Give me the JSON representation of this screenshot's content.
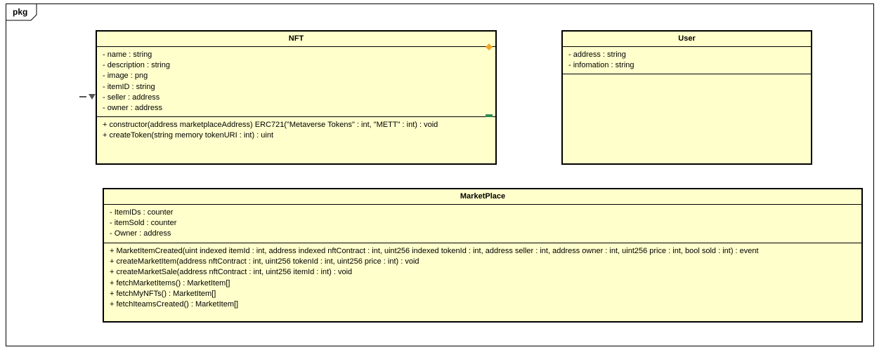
{
  "package": {
    "label": "pkg"
  },
  "classes": {
    "nft": {
      "name": "NFT",
      "attributes": [
        "- name : string",
        "- description : string",
        "- image : png",
        "- itemID : string",
        "- seller : address",
        "- owner : address"
      ],
      "operations": [
        "+ constructor(address marketplaceAddress) ERC721(\"Metaverse Tokens\" : int, \"METT\" : int) : void",
        "+ createToken(string memory tokenURI : int) : uint"
      ]
    },
    "user": {
      "name": "User",
      "attributes": [
        "- address : string",
        "- infomation : string"
      ],
      "operations": []
    },
    "market": {
      "name": "MarketPlace",
      "attributes": [
        "- ItemIDs : counter",
        "- itemSold : counter",
        "- Owner : address"
      ],
      "operations": [
        "+ MarketItemCreated(uint indexed itemId : int, address indexed nftContract : int, uint256 indexed tokenId : int, address seller : int, address owner : int, uint256 price : int, bool sold : int) : event",
        "+ createMarketItem(address nftContract : int, uint256 tokenId : int, uint256 price : int) : void",
        "+ createMarketSale(address nftContract : int, uint256 itemId : int) : void",
        "+ fetchMarketItems() : MarketItem[]",
        "+ fetchMyNFTs() : MarketItem[]",
        "+ fetchIteamsCreated() : MarketItem[]"
      ]
    }
  },
  "colors": {
    "class_fill": "#ffffcc",
    "border": "#000000",
    "attribute_marker": "#f5a623",
    "operation_marker": "#2e8b57",
    "arrow": "#555555"
  }
}
